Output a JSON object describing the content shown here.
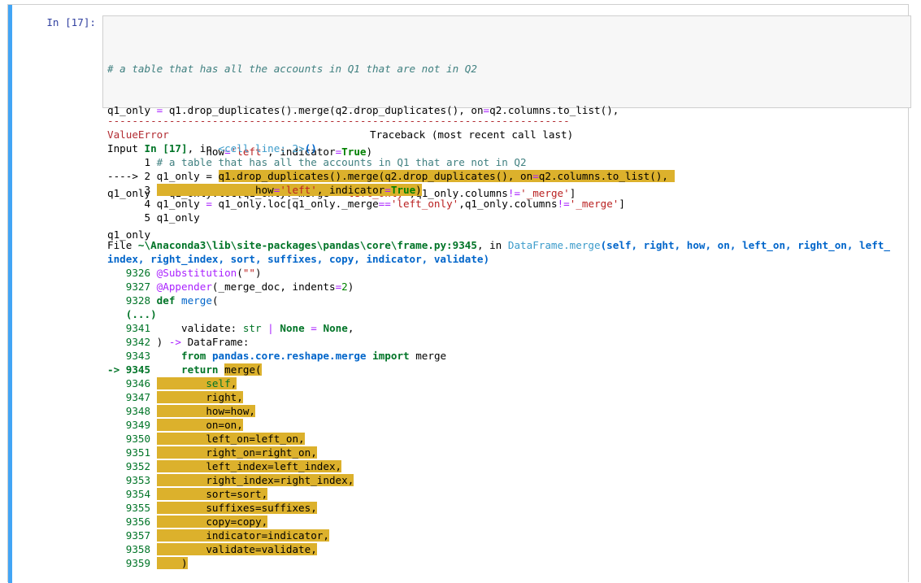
{
  "cell": {
    "prompt": "In [17]:",
    "input_lines": [
      "# a table that has all the accounts in Q1 that are not in Q2",
      "q1_only = q1.drop_duplicates().merge(q2.drop_duplicates(), on=q2.columns.to_list(),",
      "                how='left', indicator=True)",
      "q1_only = q1_only.loc[q1_only._merge=='left_only',q1_only.columns!='_merge']",
      "q1_only"
    ]
  },
  "traceback": {
    "separator": "---------------------------------------------------------------------------",
    "error_type": "ValueError",
    "traceback_header": "Traceback (most recent call last)",
    "input_ref": {
      "prefix": "Input ",
      "cell_ref": "In [17]",
      "mid": ", in ",
      "location": "<cell line: 2>",
      "suffix": "()"
    },
    "cell_frame_lines": [
      {
        "gutter": "      1 ",
        "text": "# a table that has all the accounts in Q1 that are not in Q2",
        "highlight": false
      },
      {
        "gutter": "----> 2 ",
        "pre": "q1_only = ",
        "text": "q1.drop_duplicates().merge(q2.drop_duplicates(), on=q2.columns.to_list(),",
        "highlight": true
      },
      {
        "gutter": "      3 ",
        "pre": "",
        "text": "                how='left', indicator=True)",
        "highlight": true
      },
      {
        "gutter": "      4 ",
        "text": "q1_only = q1_only.loc[q1_only._merge=='left_only',q1_only.columns!='_merge']",
        "highlight": false
      },
      {
        "gutter": "      5 ",
        "text": "q1_only",
        "highlight": false
      }
    ],
    "file_ref": {
      "prefix": "File ",
      "path": "~\\Anaconda3\\lib\\site-packages\\pandas\\core\\frame.py:9345",
      "mid": ", in ",
      "func": "DataFrame.merge",
      "args_line1": "(self, right, how, on, left_on, right_on, left_",
      "args_line2": "index, right_index, sort, suffixes, copy, indicator, validate)"
    },
    "frame_lines": [
      {
        "gutter": "   9326 ",
        "text": "@Substitution(\"\")"
      },
      {
        "gutter": "   9327 ",
        "text": "@Appender(_merge_doc, indents=2)"
      },
      {
        "gutter": "   9328 ",
        "text": "def merge("
      },
      {
        "gutter": "   (...)",
        "text": ""
      },
      {
        "gutter": "   9341 ",
        "text": "    validate: str | None = None,"
      },
      {
        "gutter": "   9342 ",
        "text": ") -> DataFrame:"
      },
      {
        "gutter": "   9343 ",
        "text": "    from pandas.core.reshape.merge import merge"
      },
      {
        "gutter": "-> 9345 ",
        "text": "    return merge("
      },
      {
        "gutter": "   9346 ",
        "text": "        self,"
      },
      {
        "gutter": "   9347 ",
        "text": "        right,"
      },
      {
        "gutter": "   9348 ",
        "text": "        how=how,"
      },
      {
        "gutter": "   9349 ",
        "text": "        on=on,"
      },
      {
        "gutter": "   9350 ",
        "text": "        left_on=left_on,"
      },
      {
        "gutter": "   9351 ",
        "text": "        right_on=right_on,"
      },
      {
        "gutter": "   9352 ",
        "text": "        left_index=left_index,"
      },
      {
        "gutter": "   9353 ",
        "text": "        right_index=right_index,"
      },
      {
        "gutter": "   9354 ",
        "text": "        sort=sort,"
      },
      {
        "gutter": "   9355 ",
        "text": "        suffixes=suffixes,"
      },
      {
        "gutter": "   9356 ",
        "text": "        copy=copy,"
      },
      {
        "gutter": "   9357 ",
        "text": "        indicator=indicator,"
      },
      {
        "gutter": "   9358 ",
        "text": "        validate=validate,"
      },
      {
        "gutter": "   9359 ",
        "text": "    )"
      }
    ]
  },
  "colors": {
    "cell_bar": "#42a5f5",
    "highlight": "#dcb12c",
    "prompt": "#303f9f"
  }
}
